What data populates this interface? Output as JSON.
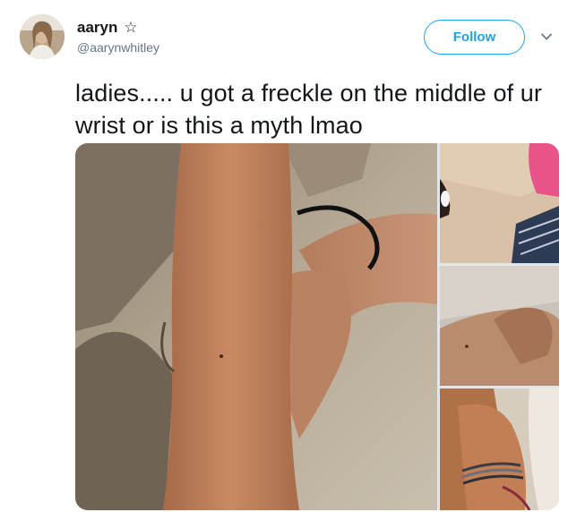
{
  "tweet": {
    "display_name": "aaryn",
    "badge_icon": "star-icon",
    "badge_glyph": "☆",
    "handle": "@aarynwhitley",
    "follow_label": "Follow",
    "menu_icon": "chevron-down-icon",
    "text": "ladies..... u got a freckle on the middle of ur wrist or is this a myth lmao"
  },
  "media": {
    "images": [
      {
        "name": "photo-wrist-freckle-large"
      },
      {
        "name": "photo-wrist-top"
      },
      {
        "name": "photo-wrist-middle"
      },
      {
        "name": "photo-wrist-bracelet"
      }
    ]
  },
  "colors": {
    "accent": "#1da1f2",
    "text": "#14171a",
    "secondary_text": "#657786"
  }
}
